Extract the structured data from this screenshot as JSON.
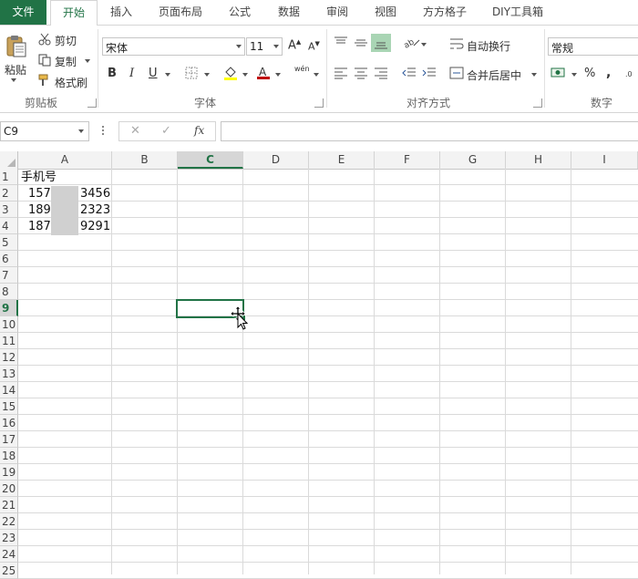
{
  "tabs": [
    {
      "label": "文件"
    },
    {
      "label": "开始"
    },
    {
      "label": "插入"
    },
    {
      "label": "页面布局"
    },
    {
      "label": "公式"
    },
    {
      "label": "数据"
    },
    {
      "label": "审阅"
    },
    {
      "label": "视图"
    },
    {
      "label": "方方格子"
    },
    {
      "label": "DIY工具箱"
    }
  ],
  "clipboard": {
    "paste_label": "粘贴",
    "cut_label": "剪切",
    "copy_label": "复制",
    "format_painter_label": "格式刷",
    "group_title": "剪贴板"
  },
  "font": {
    "font_name": "宋体",
    "font_size": "11",
    "bold": "B",
    "italic": "I",
    "underline": "U",
    "phonetic": "wén",
    "group_title": "字体"
  },
  "alignment": {
    "wrap_text_label": "自动换行",
    "merge_center_label": "合并后居中",
    "group_title": "对齐方式"
  },
  "number": {
    "format": "常规",
    "percent": "%",
    "comma": ",",
    "group_title": "数字"
  },
  "formula_bar": {
    "name_box": "C9",
    "cancel": "✕",
    "enter": "✓",
    "fx": "fx",
    "content": ""
  },
  "columns": [
    "A",
    "B",
    "C",
    "D",
    "E",
    "F",
    "G",
    "H",
    "I"
  ],
  "rows": [
    "1",
    "2",
    "3",
    "4",
    "5",
    "6",
    "7",
    "8",
    "9",
    "10",
    "11",
    "12",
    "13",
    "14",
    "15",
    "16",
    "17",
    "18",
    "19",
    "20",
    "21",
    "22",
    "23",
    "24",
    "25"
  ],
  "cells": {
    "A1": "手机号",
    "A2_prefix": "157",
    "A2_suffix": "3456",
    "A3_prefix": "189",
    "A3_suffix": "2323",
    "A4_prefix": "187",
    "A4_suffix": "9291"
  },
  "selected_cell": "C9",
  "accent_color": "#217346"
}
